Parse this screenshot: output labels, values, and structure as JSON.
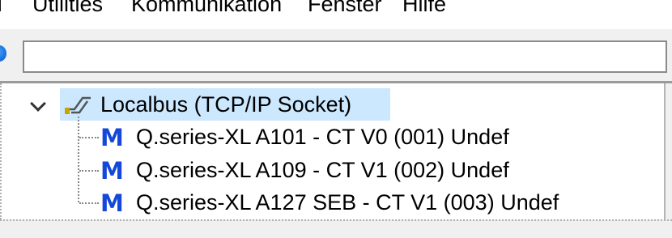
{
  "menubar": {
    "items": [
      "Utilities",
      "Kommunikation",
      "Fenster",
      "Hilfe"
    ]
  },
  "toolbar": {
    "address_value": "",
    "icon": "globe-icon"
  },
  "tree": {
    "root": {
      "label": "Localbus (TCP/IP Socket)",
      "icon": "plug-icon",
      "expanded": true,
      "selected": true
    },
    "children": [
      {
        "icon": "m-icon",
        "label": "Q.series-XL A101 - CT V0 (001) Undef"
      },
      {
        "icon": "m-icon",
        "label": "Q.series-XL A109 - CT V1 (002) Undef"
      },
      {
        "icon": "m-icon",
        "label": "Q.series-XL A127 SEB - CT V1 (003) Undef"
      }
    ]
  },
  "colors": {
    "selection": "#cce8ff",
    "m_icon": "#1448d8"
  }
}
